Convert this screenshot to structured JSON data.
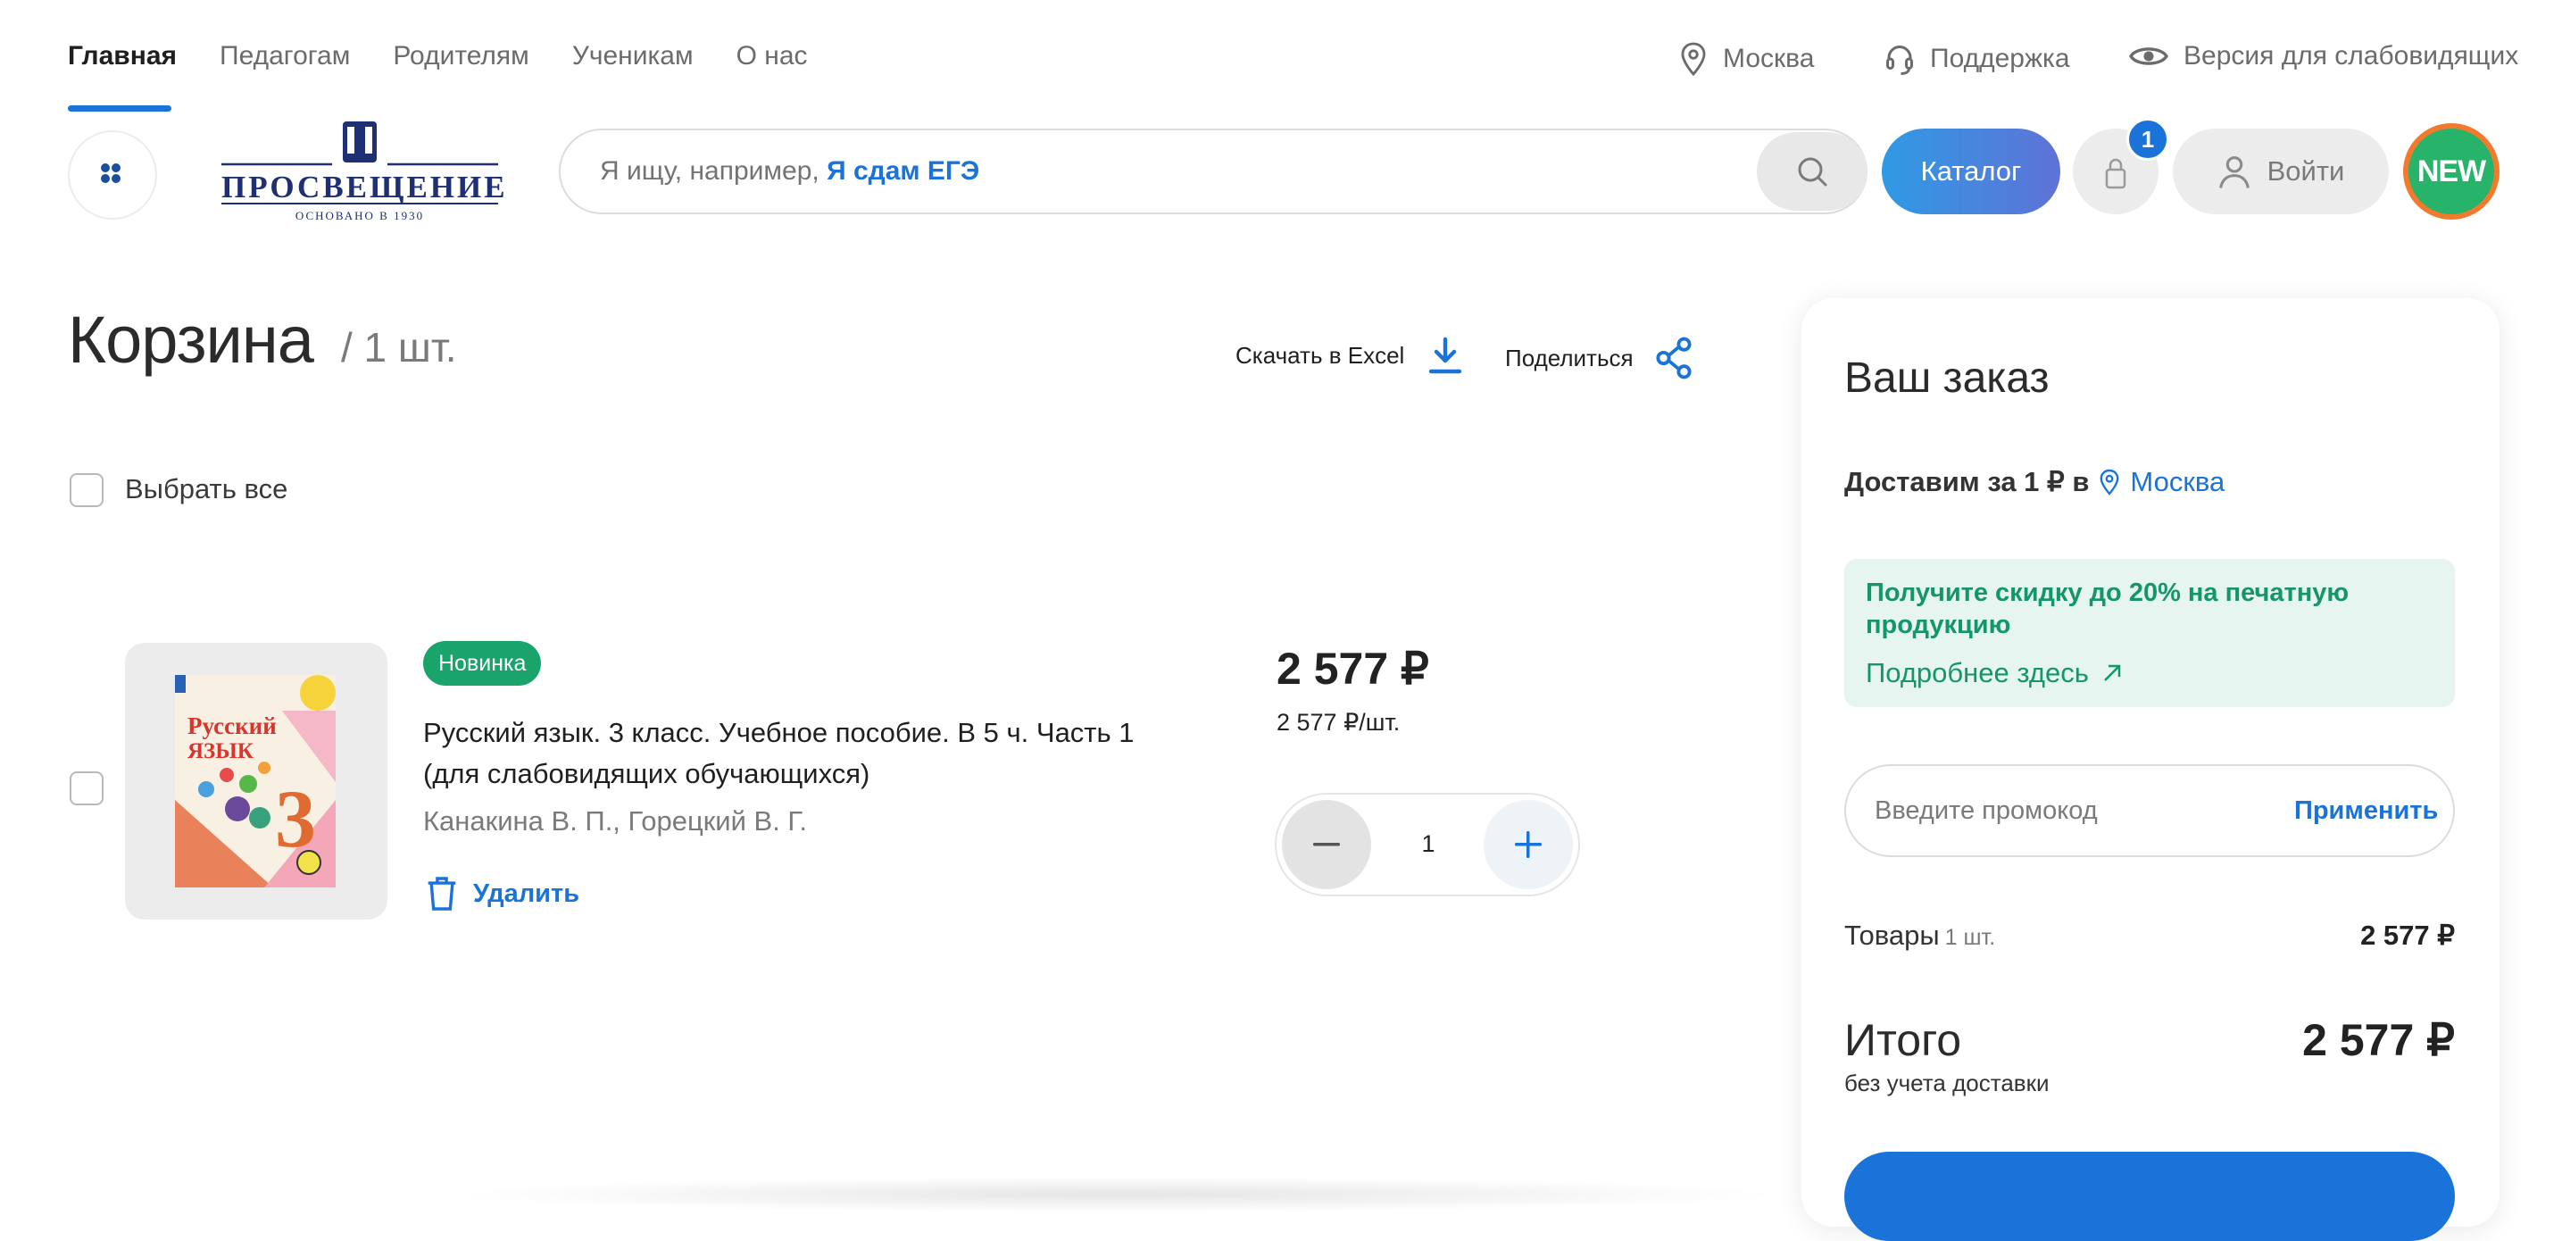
{
  "topnav": {
    "items": [
      "Главная",
      "Педагогам",
      "Родителям",
      "Ученикам",
      "О нас"
    ],
    "city": "Москва",
    "support": "Поддержка",
    "accessibility": "Версия для слабовидящих"
  },
  "header": {
    "logo_text": "ПРОСВЕЩЕНИЕ",
    "logo_sub": "ОСНОВАНО В 1930",
    "search_placeholder": "Я ищу, например,",
    "search_hint": "Я сдам ЕГЭ",
    "catalog": "Каталог",
    "cart_count": "1",
    "login": "Войти",
    "new_badge": "NEW"
  },
  "cart": {
    "title": "Корзина",
    "count": "/ 1 шт.",
    "download_excel": "Скачать в Excel",
    "share": "Поделиться",
    "select_all": "Выбрать все"
  },
  "product": {
    "badge": "Новинка",
    "title": "Русский язык. 3 класс. Учебное пособие. В 5 ч. Часть 1 (для слабовидящих обучающихся)",
    "authors": "Канакина В. П., Горецкий В. Г.",
    "delete": "Удалить",
    "price": "2 577 ₽",
    "price_unit": "2 577 ₽/шт.",
    "quantity": "1",
    "cover_title_1": "Русский",
    "cover_title_2": "язык",
    "cover_grade": "3"
  },
  "order": {
    "title": "Ваш заказ",
    "deliver_prefix": "Доставим за 1 ₽ в",
    "deliver_city": "Москва",
    "promo_head": "Получите скидку до 20% на печатную продукцию",
    "promo_link": "Подробнее здесь",
    "promo_placeholder": "Введите промокод",
    "promo_apply": "Применить",
    "goods_label": "Товары",
    "goods_count": "1 шт.",
    "goods_value": "2 577 ₽",
    "total_label": "Итого",
    "total_value": "2 577 ₽",
    "total_sub": "без учета доставки"
  },
  "colors": {
    "accent": "#1a73d9",
    "green": "#1aa36a",
    "promo_bg": "#e6f5ef"
  }
}
